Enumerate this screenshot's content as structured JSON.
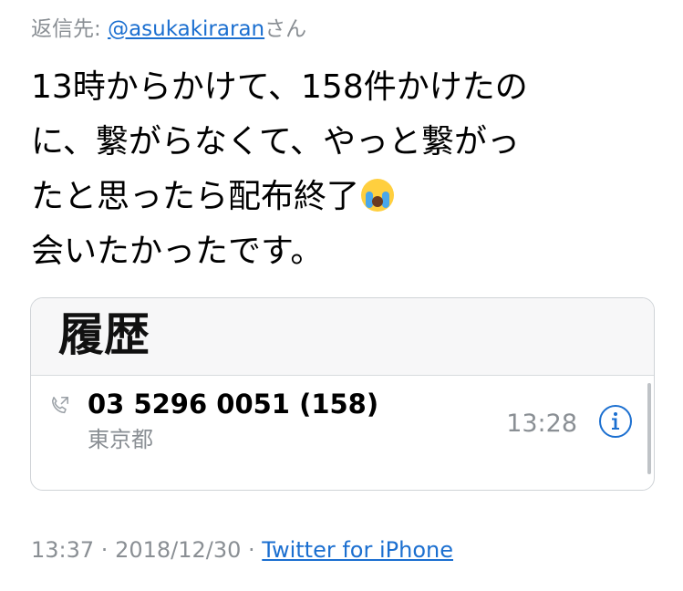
{
  "reply": {
    "prefix": "返信先: ",
    "handle": "@asukakiraran",
    "suffix": "さん"
  },
  "tweet": {
    "lines": [
      "13時からかけて、158件かけたの",
      "に、繋がらなくて、やっと繋がっ",
      "たと思ったら配布終了",
      "会いたかったです。"
    ],
    "emoji": "loudly-crying-face"
  },
  "card": {
    "title": "履歴",
    "call": {
      "number": "03 5296 0051 (158)",
      "location": "東京都",
      "time": "13:28"
    },
    "colors": {
      "info_icon": "#1b6fd0"
    }
  },
  "meta": {
    "time": "13:37",
    "separator": " · ",
    "date": "2018/12/30",
    "separator2": " · ",
    "source": "Twitter for iPhone"
  }
}
